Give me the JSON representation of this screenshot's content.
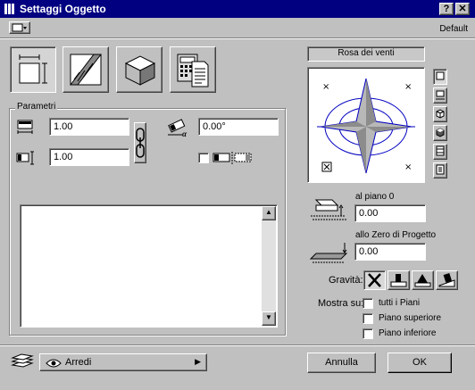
{
  "window": {
    "title": "Settaggi Oggetto",
    "help_label": "?",
    "close_label": "✕"
  },
  "topbar": {
    "preset_label": "Default"
  },
  "tabs": [
    {
      "name": "tab-dimensions",
      "icon": "dimension-box-icon"
    },
    {
      "name": "tab-floor-plan",
      "icon": "hatched-section-icon"
    },
    {
      "name": "tab-3d",
      "icon": "cube-icon"
    },
    {
      "name": "tab-listing",
      "icon": "calculator-document-icon"
    }
  ],
  "params": {
    "group_label": "Parametri",
    "width_value": "1.00",
    "depth_value": "1.00",
    "angle_value": "0.00°"
  },
  "compass": {
    "label": "Rosa dei venti",
    "colors": {
      "fill": "#b8b8b8",
      "stroke": "#0000c0"
    }
  },
  "elevation": {
    "story_label": "al piano 0",
    "story_value": "0.00",
    "project_zero_label": "allo Zero di Progetto",
    "project_zero_value": "0.00"
  },
  "gravity": {
    "label": "Gravità:"
  },
  "show_on": {
    "label": "Mostra su:",
    "options": [
      "tutti i Piani",
      "Piano superiore",
      "Piano inferiore"
    ]
  },
  "layer": {
    "value": "Arredi"
  },
  "footer": {
    "cancel_label": "Annulla",
    "ok_label": "OK"
  }
}
